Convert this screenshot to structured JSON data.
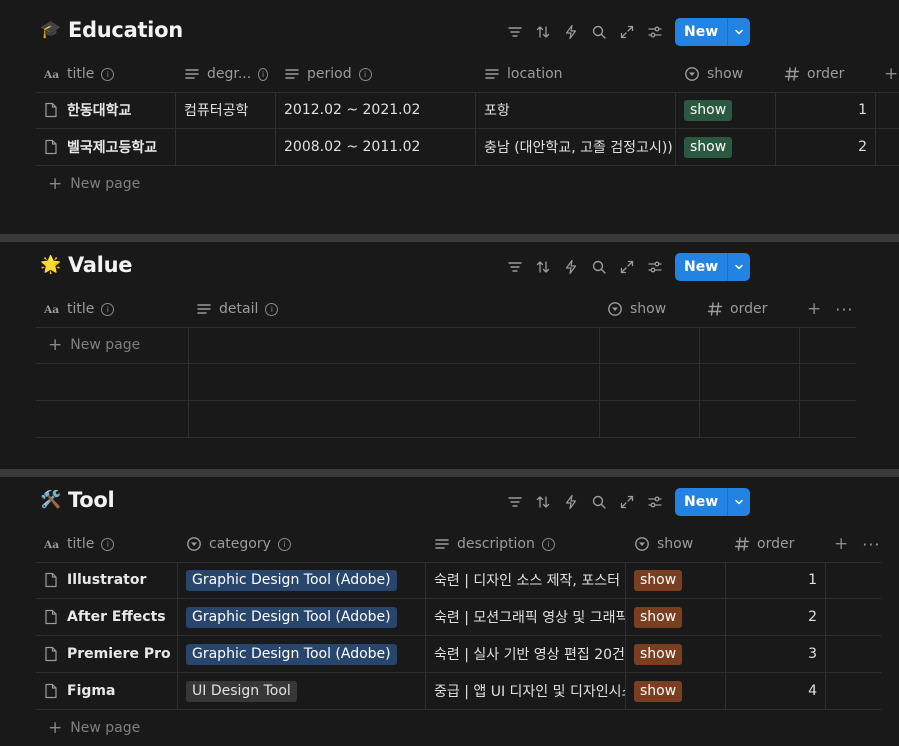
{
  "toolbar_icons": [
    "filter-icon",
    "sort-icon",
    "lightning-icon",
    "search-icon",
    "expand-icon",
    "settings-icon"
  ],
  "new_button_label": "New",
  "new_page_label": "New page",
  "education": {
    "icon": "🎓",
    "title": "Education",
    "columns": [
      "title",
      "degr...",
      "period",
      "location",
      "show",
      "order"
    ],
    "rows": [
      {
        "title": "한동대학교",
        "degree": "컴퓨터공학",
        "period": "2012.02 ~ 2021.02",
        "location": "포항",
        "show": "show",
        "order": "1"
      },
      {
        "title": "벨국제고등학교",
        "degree": "",
        "period": "2008.02 ~ 2011.02",
        "location": "충남 (대안학교, 고졸 검정고시))",
        "show": "show",
        "order": "2"
      }
    ]
  },
  "value": {
    "icon": "🌟",
    "title": "Value",
    "columns": [
      "title",
      "detail",
      "show",
      "order"
    ]
  },
  "tool": {
    "icon": "🛠️",
    "title": "Tool",
    "columns": [
      "title",
      "category",
      "description",
      "show",
      "order"
    ],
    "rows": [
      {
        "title": "Illustrator",
        "category": "Graphic Design Tool (Adobe)",
        "description": "숙련 | 디자인 소스 제작, 포스터 및",
        "show": "show",
        "order": "1"
      },
      {
        "title": "After Effects",
        "category": "Graphic Design Tool (Adobe)",
        "description": "숙련 | 모션그래픽 영상 및 그래픽 작",
        "show": "show",
        "order": "2"
      },
      {
        "title": "Premiere Pro",
        "category": "Graphic Design Tool (Adobe)",
        "description": "숙련 | 실사 기반 영상 편집 20건+",
        "show": "show",
        "order": "3"
      },
      {
        "title": "Figma",
        "category": "UI Design Tool",
        "description": "중급 | 앱 UI 디자인 및 디자인시스템",
        "show": "show",
        "order": "4"
      }
    ]
  }
}
